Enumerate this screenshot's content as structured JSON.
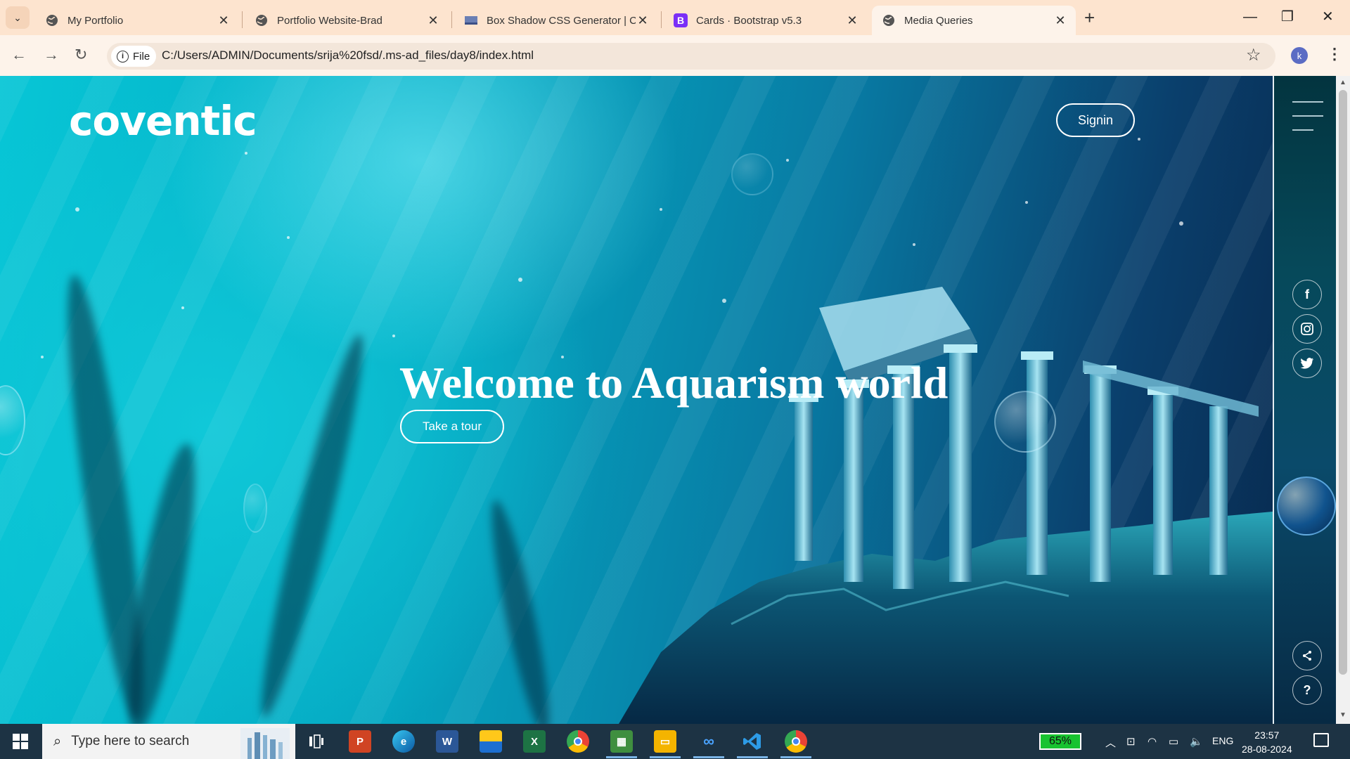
{
  "browser": {
    "tabs": [
      {
        "title": "My Portfolio",
        "favicon": "globe-icon",
        "active": false
      },
      {
        "title": "Portfolio Website-Brad",
        "favicon": "globe-icon",
        "active": false
      },
      {
        "title": "Box Shadow CSS Generator | CS",
        "favicon": "box-shadow-icon",
        "active": false
      },
      {
        "title": "Cards · Bootstrap v5.3",
        "favicon": "bootstrap-icon",
        "active": false
      },
      {
        "title": "Media Queries",
        "favicon": "globe-icon",
        "active": true
      }
    ],
    "new_tab": "+",
    "site_chip": "File",
    "url": "C:/Users/ADMIN/Documents/srija%20fsd/.ms-ad_files/day8/index.html",
    "profile_initial": "k"
  },
  "page": {
    "logo": "coventic",
    "signin_label": "Signin",
    "headline": "Welcome to Aquarism world",
    "cta_label": "Take a tour",
    "social": [
      {
        "icon": "facebook-icon",
        "glyph": "f"
      },
      {
        "icon": "instagram-icon",
        "glyph": "◎"
      },
      {
        "icon": "twitter-icon",
        "glyph": "🐦"
      }
    ],
    "share_glyph": "<",
    "help_glyph": "?",
    "colors": {
      "accent": "#ffffff",
      "sidebar": "#06495a"
    }
  },
  "taskbar": {
    "search_placeholder": "Type here to search",
    "battery": "65%",
    "language": "ENG",
    "time": "23:57",
    "date": "28-08-2024"
  }
}
